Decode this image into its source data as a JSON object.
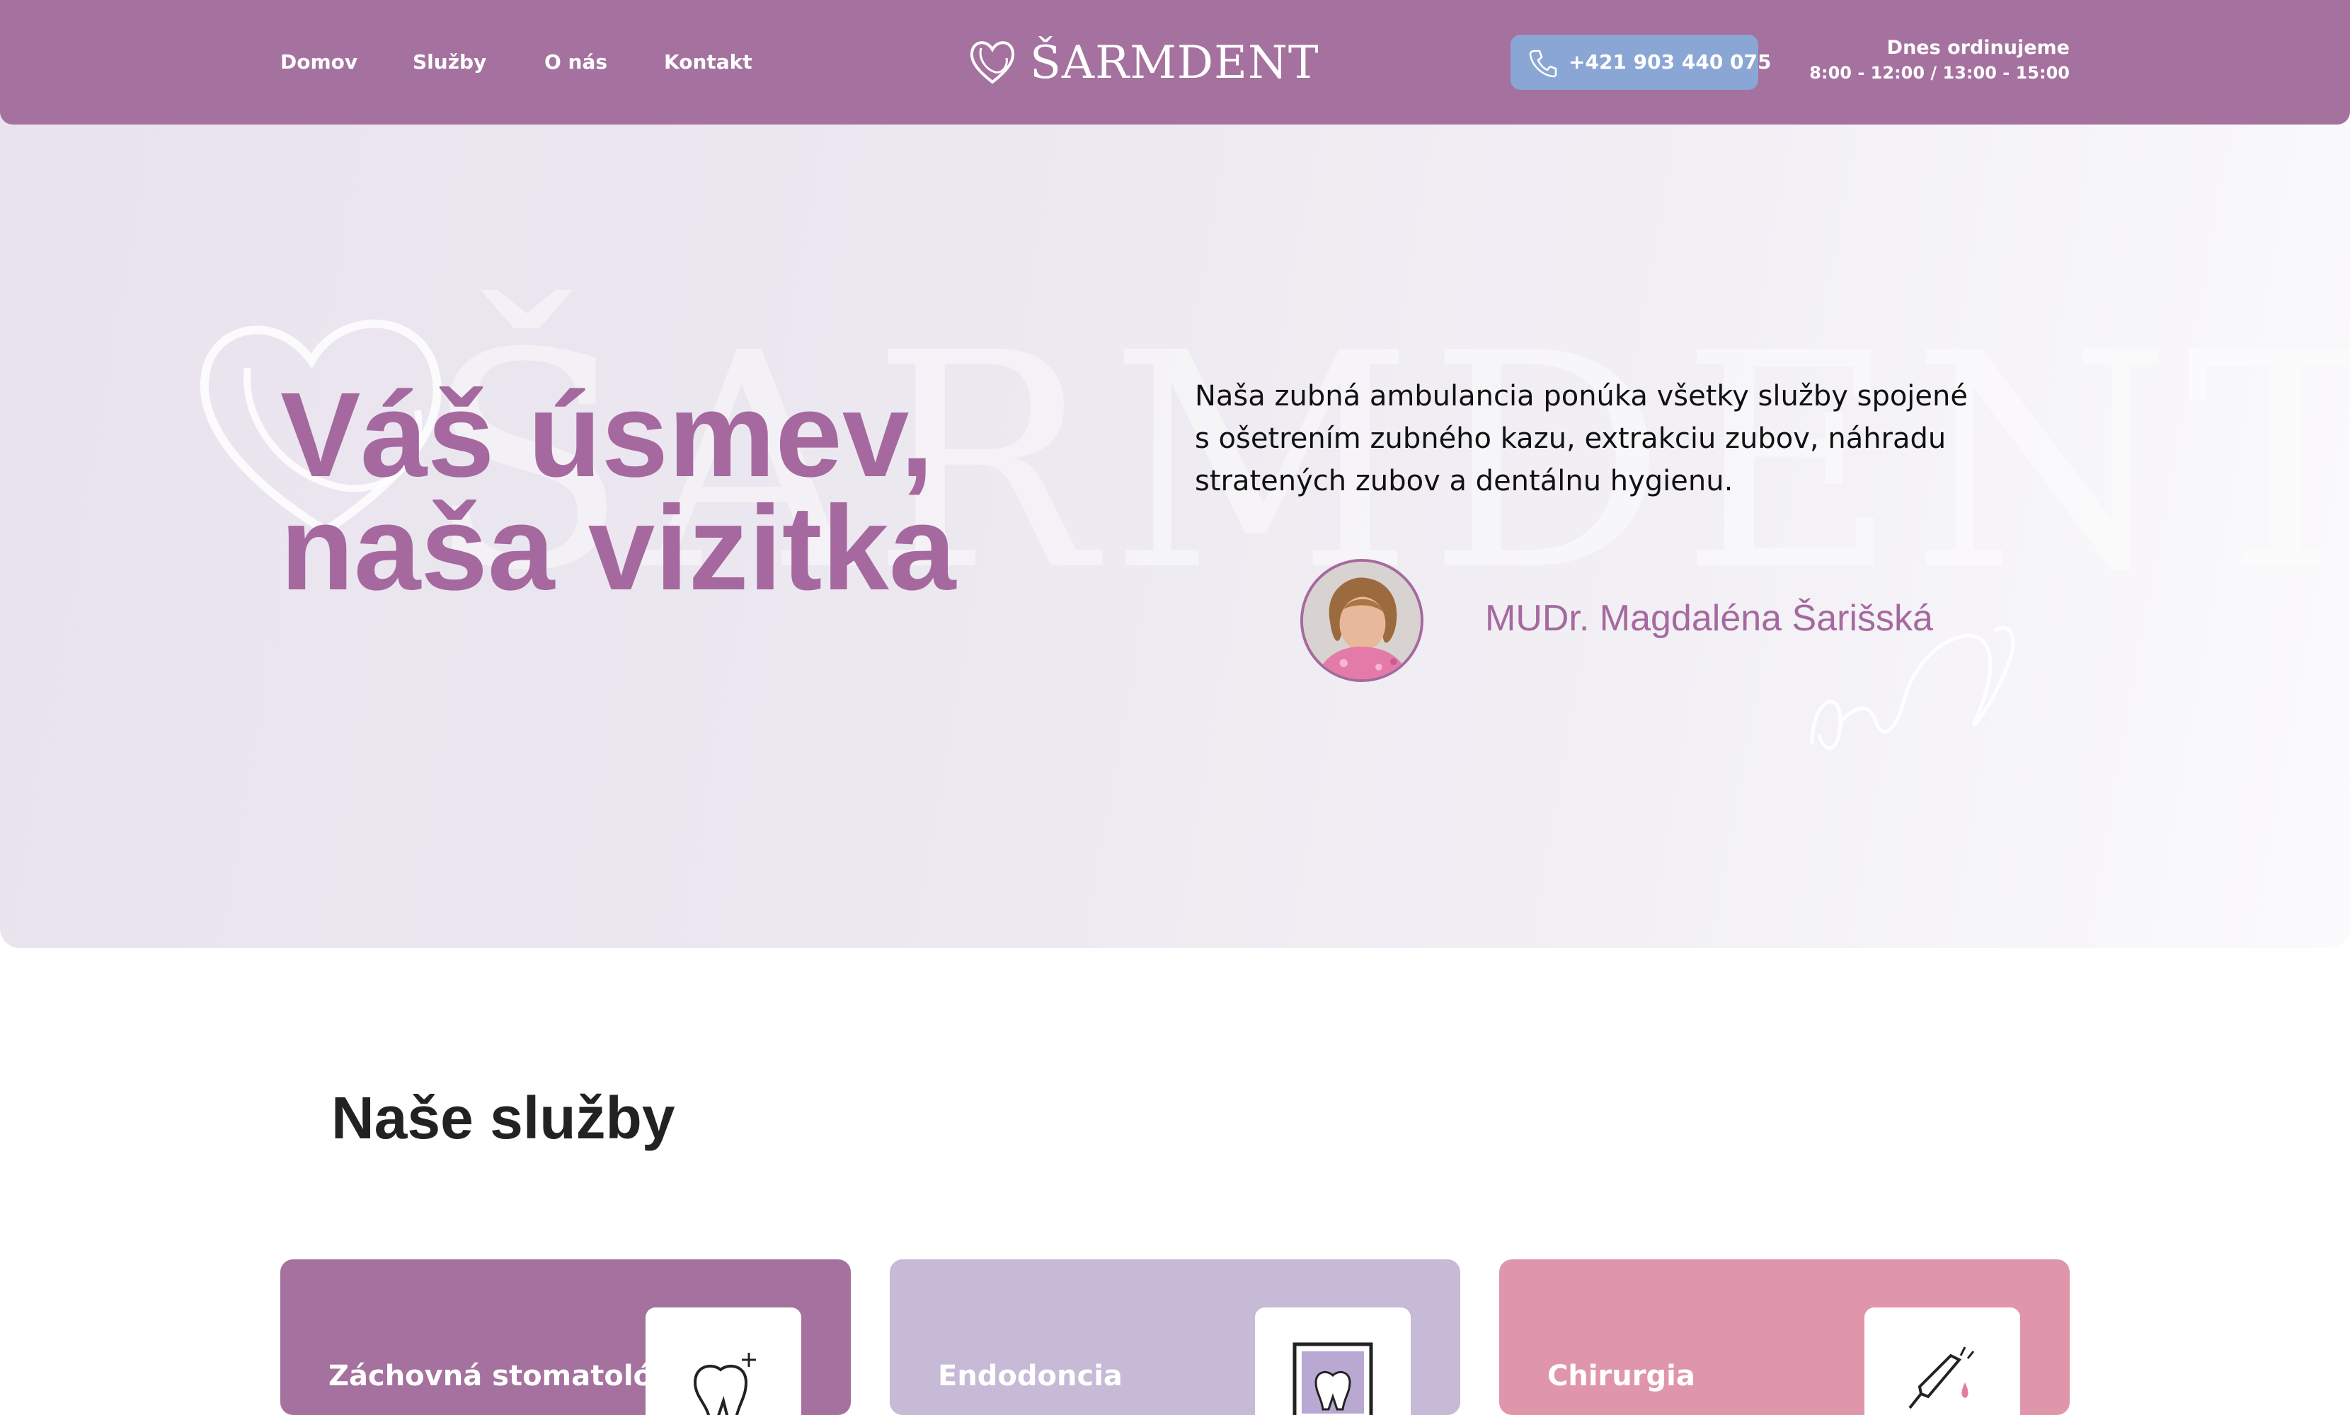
{
  "header": {
    "nav": [
      "Domov",
      "Služby",
      "O nás",
      "Kontakt"
    ],
    "logo_text": "ŠARMDENT",
    "phone": "+421 903 440 075",
    "hours_title": "Dnes ordinujeme",
    "hours_value": "8:00 - 12:00 / 13:00 - 15:00"
  },
  "hero": {
    "title_line1": "Váš úsmev,",
    "title_line2": "naša vizitka",
    "description": "Naša zubná ambulancia ponúka všetky služby spojené s ošetrením zubného kazu, extrakciu zubov, náhradu stratených zubov a dentálnu hygienu.",
    "doctor_name": "MUDr. Magdaléna Šarišská",
    "watermark": "ŠARMDENT"
  },
  "services": {
    "title": "Naše služby",
    "cards": [
      {
        "title": "Záchovná stomatológia",
        "color": "#a5719e"
      },
      {
        "title": "Endodoncia",
        "color": "#c6bad6"
      },
      {
        "title": "Chirurgia",
        "color": "#e096aa"
      }
    ]
  },
  "colors": {
    "brand": "#a5719e",
    "brand_text": "#a5699f",
    "phone_button": "#8aa6d4"
  },
  "icons": [
    "heart-logo-icon",
    "phone-icon",
    "tooth-sparkle-icon",
    "tooth-xray-icon",
    "syringe-icon"
  ]
}
